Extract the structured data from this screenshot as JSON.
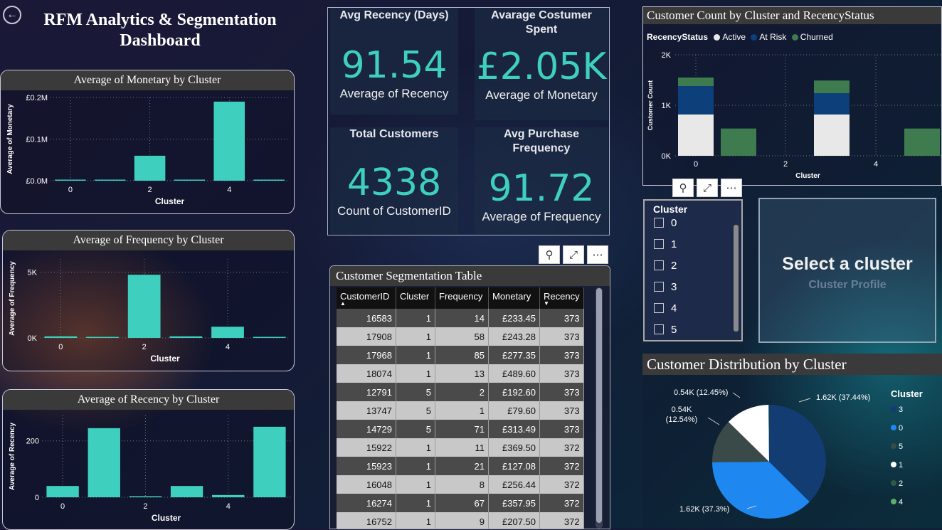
{
  "header": {
    "title": "RFM Analytics & Segmentation Dashboard",
    "back_icon": "back-arrow-icon"
  },
  "monetary_chart": {
    "title": "Average of Monetary by Cluster"
  },
  "frequency_chart": {
    "title": "Average of Frequency by Cluster"
  },
  "recency_chart": {
    "title": "Average of Recency by Cluster"
  },
  "kpis": [
    {
      "title": "Avg Recency (Days)",
      "value": "91.54",
      "sub": "Average of Recency"
    },
    {
      "title": "Avarage Costumer Spent",
      "value": "£2.05K",
      "sub": "Average of Monetary"
    },
    {
      "title": "Total Customers",
      "value": "4338",
      "sub": "Count of CustomerID"
    },
    {
      "title": "Avg Purchase Frequency",
      "value": "91.72",
      "sub": "Average of Frequency"
    }
  ],
  "table": {
    "title": "Customer Segmentation Table",
    "columns": [
      "CustomerID",
      "Cluster",
      "Frequency",
      "Monetary",
      "Recency"
    ],
    "rows": [
      [
        "16583",
        "1",
        "14",
        "£233.45",
        "373"
      ],
      [
        "17908",
        "1",
        "58",
        "£243.28",
        "373"
      ],
      [
        "17968",
        "1",
        "85",
        "£277.35",
        "373"
      ],
      [
        "18074",
        "1",
        "13",
        "£489.60",
        "373"
      ],
      [
        "12791",
        "5",
        "2",
        "£192.60",
        "373"
      ],
      [
        "13747",
        "5",
        "1",
        "£79.60",
        "373"
      ],
      [
        "14729",
        "5",
        "71",
        "£313.49",
        "373"
      ],
      [
        "15922",
        "1",
        "11",
        "£369.50",
        "372"
      ],
      [
        "15923",
        "1",
        "21",
        "£127.08",
        "372"
      ],
      [
        "16048",
        "1",
        "8",
        "£256.44",
        "372"
      ],
      [
        "16274",
        "1",
        "67",
        "£357.95",
        "372"
      ],
      [
        "16752",
        "1",
        "9",
        "£207.50",
        "372"
      ]
    ]
  },
  "stacked_chart": {
    "title": "Customer Count by Cluster and RecencyStatus",
    "legend_title": "RecencyStatus",
    "legend": [
      "Active",
      "At Risk",
      "Churned"
    ]
  },
  "slicer": {
    "title": "Cluster",
    "items": [
      "0",
      "1",
      "2",
      "3",
      "4",
      "5"
    ]
  },
  "profile": {
    "title": "Select a cluster",
    "subtitle": "Cluster Profile"
  },
  "pie_chart": {
    "title": "Customer Distribution by Cluster",
    "legend_title": "Cluster"
  },
  "colors": {
    "teal": "#3ecfbf",
    "active": "#e8e8e8",
    "at_risk": "#0d3f7a",
    "churned": "#3e7c4f"
  },
  "chart_data": [
    {
      "type": "bar",
      "title": "Average of Monetary by Cluster",
      "xlabel": "Cluster",
      "ylabel": "Average of Monetary",
      "categories": [
        "0",
        "1",
        "2",
        "3",
        "4",
        "5"
      ],
      "values": [
        1200,
        900,
        60000,
        1500,
        190000,
        1000
      ],
      "ylim": [
        0,
        200000
      ],
      "yticks": [
        "£0.0M",
        "£0.1M",
        "£0.2M"
      ],
      "xticks": [
        "0",
        "2",
        "4"
      ]
    },
    {
      "type": "bar",
      "title": "Average of Frequency by Cluster",
      "xlabel": "Cluster",
      "ylabel": "Average of Frequency",
      "categories": [
        "0",
        "1",
        "2",
        "3",
        "4",
        "5"
      ],
      "values": [
        120,
        60,
        4800,
        120,
        850,
        60
      ],
      "ylim": [
        0,
        6000
      ],
      "yticks": [
        "0K",
        "5K"
      ],
      "xticks": [
        "0",
        "2",
        "4"
      ]
    },
    {
      "type": "bar",
      "title": "Average of Recency by Cluster",
      "xlabel": "Cluster",
      "ylabel": "Average of Recency",
      "categories": [
        "0",
        "1",
        "2",
        "3",
        "4",
        "5"
      ],
      "values": [
        40,
        245,
        3,
        40,
        8,
        250
      ],
      "ylim": [
        0,
        290
      ],
      "yticks": [
        "0",
        "200"
      ],
      "xticks": [
        "0",
        "2",
        "4"
      ]
    },
    {
      "type": "bar",
      "stacked": true,
      "title": "Customer Count by Cluster and RecencyStatus",
      "xlabel": "Cluster",
      "ylabel": "Customer Count",
      "categories": [
        "0",
        "1",
        "2",
        "3",
        "4"
      ],
      "series": [
        {
          "name": "Active",
          "values": [
            820,
            0,
            0,
            820,
            0
          ]
        },
        {
          "name": "At Risk",
          "values": [
            560,
            0,
            0,
            420,
            0
          ]
        },
        {
          "name": "Churned",
          "values": [
            170,
            540,
            0,
            250,
            540
          ]
        }
      ],
      "ylim": [
        0,
        2000
      ],
      "yticks": [
        "0K",
        "1K",
        "2K"
      ],
      "xticks": [
        "0",
        "2",
        "4"
      ]
    },
    {
      "type": "pie",
      "title": "Customer Distribution by Cluster",
      "categories": [
        "3",
        "0",
        "5",
        "1",
        "2",
        "4"
      ],
      "values": [
        1620,
        1620,
        540,
        540,
        4,
        4
      ],
      "labels": [
        "1.62K (37.44%)",
        "1.62K (37.3%)",
        "0.54K (12.54%)",
        "0.54K (12.45%)",
        "",
        ""
      ],
      "colors": [
        "#123c72",
        "#1e88f0",
        "#3a4a48",
        "#ffffff",
        "#2e5a48",
        "#5ab06a"
      ]
    }
  ]
}
